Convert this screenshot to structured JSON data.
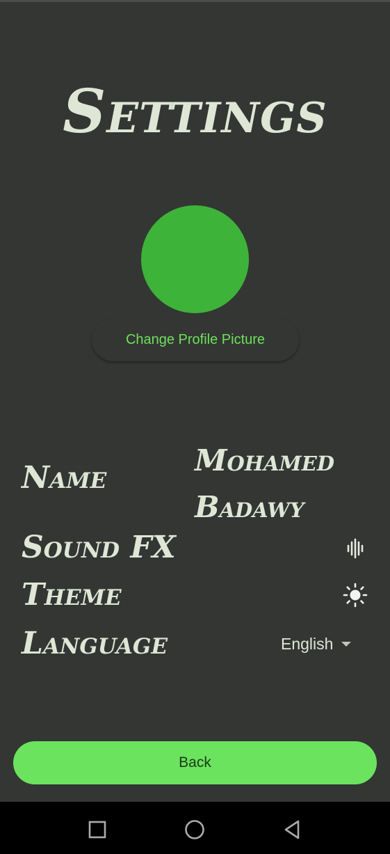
{
  "header": {
    "title": "Settings"
  },
  "profile": {
    "change_picture_label": "Change Profile Picture",
    "avatar_color": "#3db33a"
  },
  "settings": {
    "name_label": "Name",
    "name_value_line1": "Mohamed",
    "name_value_line2": "Badawy",
    "sound_label": "Sound FX",
    "sound_icon": "sound-wave-icon",
    "theme_label": "Theme",
    "theme_icon": "sun-icon",
    "language_label": "Language",
    "language_value": "English"
  },
  "footer": {
    "back_label": "Back"
  },
  "navbar": {
    "buttons": [
      "recents-square-icon",
      "home-circle-icon",
      "back-triangle-icon"
    ]
  },
  "colors": {
    "background": "#333633",
    "accent": "#6be35f",
    "text": "#dfe6d6"
  }
}
